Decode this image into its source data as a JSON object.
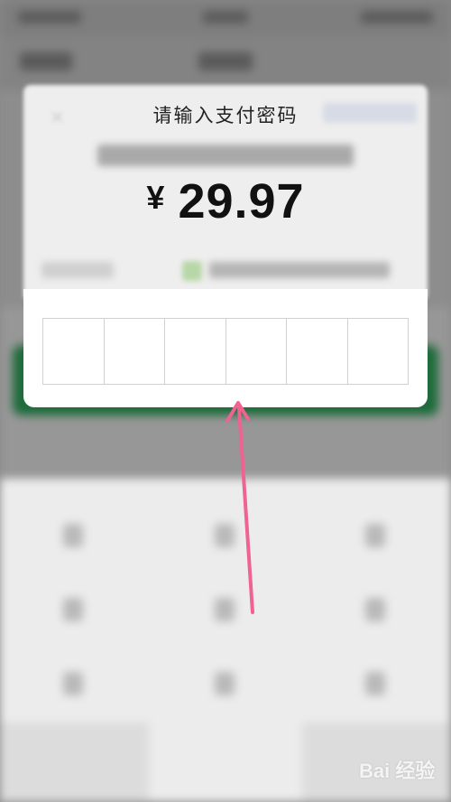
{
  "dialog": {
    "title": "请输入支付密码",
    "amount": {
      "currency": "¥",
      "value": "29.97"
    },
    "pin_length": 6
  },
  "watermark": {
    "text": "Bai 经验"
  },
  "colors": {
    "pay_button_green": "#1e6b3b",
    "annotation_arrow": "#f06292"
  },
  "icons": [
    "close-icon",
    "paw-logo-icon",
    "arrow-up-icon"
  ]
}
